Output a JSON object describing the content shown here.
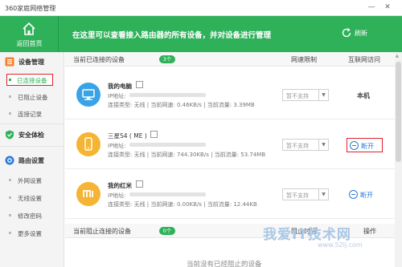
{
  "window": {
    "title": "360家庭网络管理",
    "minimize": "—",
    "close": "✕"
  },
  "header": {
    "back_label": "返回首页",
    "headline": "在这里可以查看接入路由器的所有设备，并对设备进行管理",
    "refresh_label": "刷新"
  },
  "sidebar": {
    "groups": [
      {
        "label": "设备管理",
        "icon": "device-manage-icon"
      },
      {
        "label": "安全体检",
        "icon": "shield-check-icon"
      },
      {
        "label": "路由设置",
        "icon": "router-gear-icon"
      }
    ],
    "items": [
      {
        "label": "已连接设备",
        "active": true
      },
      {
        "label": "已阻止设备"
      },
      {
        "label": "连接记录"
      },
      {
        "label": "外网设置"
      },
      {
        "label": "无线设置"
      },
      {
        "label": "修改密码"
      },
      {
        "label": "更多设置"
      }
    ]
  },
  "connected": {
    "title": "当前已连接的设备",
    "count": "3个",
    "col_speed": "网速限制",
    "col_access": "互联网访问"
  },
  "devices": [
    {
      "name": "我的电脑",
      "icon": "computer-icon",
      "icon_color": "#3aa3e8",
      "ip_label": "IP地址:",
      "conn_info": "连接类型: 无线 | 当前网速: 0.46KB/s | 当前流量: 3.39MB",
      "speed_limit": "暂不支持",
      "access": "本机"
    },
    {
      "name": "三星S4 ( ME )",
      "icon": "phone-icon",
      "icon_color": "#f5b433",
      "ip_label": "IP地址:",
      "conn_info": "连接类型: 无线 | 当前网速: 744.30KB/s | 当前流量: 53.74MB",
      "speed_limit": "暂不支持",
      "access": "断开"
    },
    {
      "name": "我的红米",
      "icon": "mi-logo-icon",
      "icon_color": "#f5b433",
      "ip_label": "IP地址:",
      "conn_info": "连接类型: 无线 | 当前网速: 0.00KB/s | 当前流量: 12.44KB",
      "speed_limit": "暂不支持",
      "access": "断开"
    }
  ],
  "blocked": {
    "title": "当前阻止连接的设备",
    "count": "0个",
    "col_time": "阻止时间",
    "col_action": "操作",
    "empty": "当前没有已经阻止的设备"
  },
  "watermark": {
    "title": "我爱IT技术网",
    "url": "www.52ij.com"
  },
  "colors": {
    "brand_green": "#2fb15a",
    "link_blue": "#2a7ad8",
    "highlight_red": "#e0202a"
  }
}
